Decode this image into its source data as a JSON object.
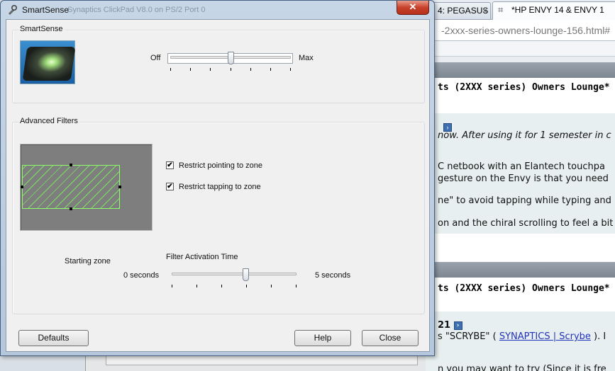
{
  "browser": {
    "tab1_label": "4: PEGASUS",
    "tab1_close": "×",
    "tab2_icon": "⌗",
    "tab2_label": "*HP ENVY 14 & ENVY 1",
    "address": "-2xxx-series-owners-lounge-156.html#",
    "post1_title": "ts (2XXX series) Owners Lounge*",
    "post1_line1": "now. After using it for 1 semester in c",
    "post1_line2": "C netbook with an Elantech touchpa",
    "post1_line3": "gesture on the Envy is that you need",
    "post1_line4": "ne\" to avoid tapping while typing and",
    "post1_line5": "on and the chiral scrolling to feel a bit",
    "post2_title": "ts (2XXX series) Owners Lounge*",
    "post2_num": "21",
    "post2_line1_pre": "s \"SCRYBE\" (",
    "post2_link": "SYNAPTICS | Scrybe",
    "post2_line1_post": "). I",
    "post2_line2": "n you may want to try (Since it is fre"
  },
  "dialog": {
    "title": "SmartSense",
    "ghost_title": "Synaptics ClickPad V8.0 on PS/2 Port 0",
    "close_glyph": "✕",
    "smartsense_group": "SmartSense",
    "smart_min": "Off",
    "smart_max": "Max",
    "smart_level": 0.5,
    "filters_group": "Advanced Filters",
    "zone_caption": "Starting zone",
    "restrict_pointing": "Restrict pointing to zone",
    "restrict_tapping": "Restrict tapping to zone",
    "restrict_pointing_checked": true,
    "restrict_tapping_checked": true,
    "activation_title": "Filter Activation Time",
    "activation_min": "0 seconds",
    "activation_max": "5 seconds",
    "activation_level": 0.6,
    "check_glyph": "✔",
    "defaults_btn": "Defaults",
    "help_btn": "Help",
    "close_btn": "Close"
  }
}
